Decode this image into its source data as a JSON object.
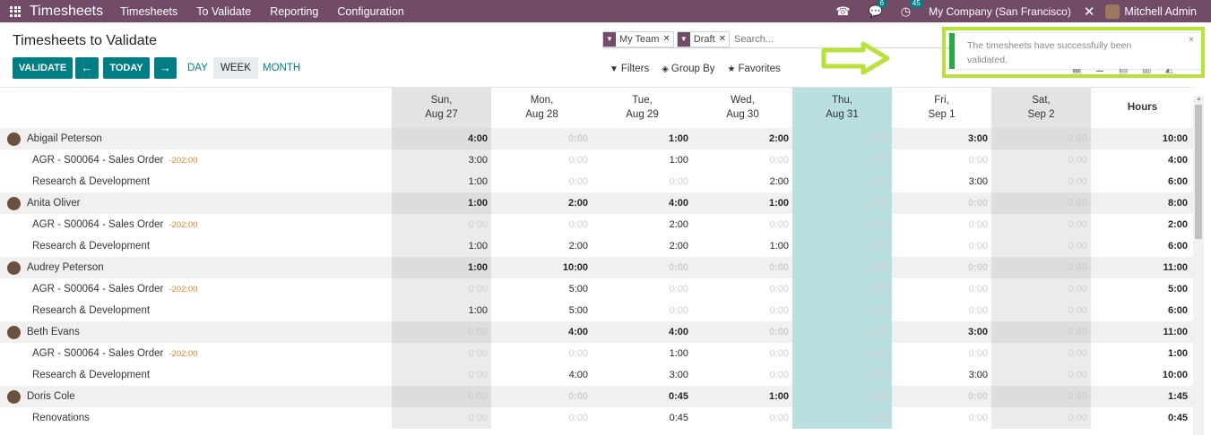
{
  "navbar": {
    "app_name": "Timesheets",
    "menus": [
      "Timesheets",
      "To Validate",
      "Reporting",
      "Configuration"
    ],
    "chat_count": "6",
    "activity_count": "45",
    "company": "My Company (San Francisco)",
    "user": "Mitchell Admin",
    "brand_color": "#714b67"
  },
  "control": {
    "title": "Timesheets to Validate",
    "validate_label": "VALIDATE",
    "prev_label": "←",
    "today_label": "TODAY",
    "next_label": "→",
    "ranges": [
      "DAY",
      "WEEK",
      "MONTH"
    ],
    "active_range": "WEEK",
    "accent_color": "#017e84"
  },
  "search": {
    "facets": [
      {
        "value": "My Team"
      },
      {
        "value": "Draft"
      }
    ],
    "placeholder": "Search...",
    "filters_label": "Filters",
    "groupby_label": "Group By",
    "favorites_label": "Favorites"
  },
  "notification": {
    "message": "The timesheets have successfully been validated.",
    "close": "×"
  },
  "columns": [
    {
      "day": "Sun,",
      "date": "Aug 27",
      "kind": "weekend"
    },
    {
      "day": "Mon,",
      "date": "Aug 28",
      "kind": "normal"
    },
    {
      "day": "Tue,",
      "date": "Aug 29",
      "kind": "normal"
    },
    {
      "day": "Wed,",
      "date": "Aug 30",
      "kind": "normal"
    },
    {
      "day": "Thu,",
      "date": "Aug 31",
      "kind": "today"
    },
    {
      "day": "Fri,",
      "date": "Sep 1",
      "kind": "normal"
    },
    {
      "day": "Sat,",
      "date": "Sep 2",
      "kind": "weekend"
    }
  ],
  "hours_label": "Hours",
  "rows": [
    {
      "type": "parent",
      "label": "Abigail Peterson",
      "cells": [
        "4:00",
        "0:00",
        "1:00",
        "2:00",
        "0:00",
        "3:00",
        "0:00"
      ],
      "total": "10:00"
    },
    {
      "type": "child",
      "label": "AGR - S00064 - Sales Order",
      "amount": "-202:00",
      "cells": [
        "3:00",
        "0:00",
        "1:00",
        "0:00",
        "0:00",
        "0:00",
        "0:00"
      ],
      "total": "4:00"
    },
    {
      "type": "child",
      "label": "Research & Development",
      "cells": [
        "1:00",
        "0:00",
        "0:00",
        "2:00",
        "0:00",
        "3:00",
        "0:00"
      ],
      "total": "6:00"
    },
    {
      "type": "parent",
      "label": "Anita Oliver",
      "cells": [
        "1:00",
        "2:00",
        "4:00",
        "1:00",
        "0:00",
        "0:00",
        "0:00"
      ],
      "total": "8:00"
    },
    {
      "type": "child",
      "label": "AGR - S00064 - Sales Order",
      "amount": "-202:00",
      "cells": [
        "0:00",
        "0:00",
        "2:00",
        "0:00",
        "0:00",
        "0:00",
        "0:00"
      ],
      "total": "2:00"
    },
    {
      "type": "child",
      "label": "Research & Development",
      "cells": [
        "1:00",
        "2:00",
        "2:00",
        "1:00",
        "0:00",
        "0:00",
        "0:00"
      ],
      "total": "6:00"
    },
    {
      "type": "parent",
      "label": "Audrey Peterson",
      "cells": [
        "1:00",
        "10:00",
        "0:00",
        "0:00",
        "0:00",
        "0:00",
        "0:00"
      ],
      "total": "11:00"
    },
    {
      "type": "child",
      "label": "AGR - S00064 - Sales Order",
      "amount": "-202:00",
      "cells": [
        "0:00",
        "5:00",
        "0:00",
        "0:00",
        "0:00",
        "0:00",
        "0:00"
      ],
      "total": "5:00"
    },
    {
      "type": "child",
      "label": "Research & Development",
      "cells": [
        "1:00",
        "5:00",
        "0:00",
        "0:00",
        "0:00",
        "0:00",
        "0:00"
      ],
      "total": "6:00"
    },
    {
      "type": "parent",
      "label": "Beth Evans",
      "cells": [
        "0:00",
        "4:00",
        "4:00",
        "0:00",
        "0:00",
        "3:00",
        "0:00"
      ],
      "total": "11:00"
    },
    {
      "type": "child",
      "label": "AGR - S00064 - Sales Order",
      "amount": "-202:00",
      "cells": [
        "0:00",
        "0:00",
        "1:00",
        "0:00",
        "0:00",
        "0:00",
        "0:00"
      ],
      "total": "1:00"
    },
    {
      "type": "child",
      "label": "Research & Development",
      "cells": [
        "0:00",
        "4:00",
        "3:00",
        "0:00",
        "0:00",
        "3:00",
        "0:00"
      ],
      "total": "10:00"
    },
    {
      "type": "parent",
      "label": "Doris Cole",
      "cells": [
        "0:00",
        "0:00",
        "0:45",
        "1:00",
        "0:00",
        "0:00",
        "0:00"
      ],
      "total": "1:45"
    },
    {
      "type": "child",
      "label": "Renovations",
      "cells": [
        "0:00",
        "0:00",
        "0:45",
        "0:00",
        "0:00",
        "0:00",
        "0:00"
      ],
      "total": "0:45"
    }
  ]
}
